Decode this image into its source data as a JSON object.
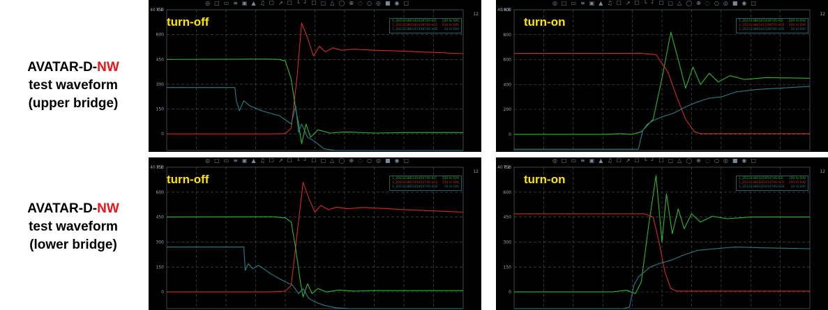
{
  "rows": [
    {
      "prefix": "AVATAR-D-",
      "highlight": "NW",
      "line2": "test waveform",
      "line3": "(upper bridge)"
    },
    {
      "prefix": "AVATAR-D-",
      "highlight": "NW",
      "line2": "test waveform",
      "line3": "(lower bridge)"
    }
  ],
  "colors": {
    "ice": "#d42a2a",
    "vce": "#2fb82f",
    "vge": "#2a7f86",
    "title": "#ffe600",
    "highlight": "#e8151b",
    "grid": "#4a5a5e"
  },
  "chart_data": [
    {
      "type": "line",
      "title": "turn-off",
      "corner_label": "40 ICE",
      "corner_right": "12",
      "y_ticks": [
        750,
        600,
        450,
        300,
        150,
        0
      ],
      "legend": [
        {
          "name": "1_2023138614132874S-ICE",
          "scale": "150 A/ DIV"
        },
        {
          "name": "1_2023138614132874S-VCE",
          "scale": "150 V/ DIV"
        },
        {
          "name": "1_2023138614132874S-VGE",
          "scale": "10 V/ DIV"
        }
      ],
      "x_range": [
        0,
        10
      ],
      "y_range": [
        -100,
        750
      ],
      "series": [
        {
          "color": "ice",
          "x": [
            0,
            3.5,
            4.0,
            4.2,
            4.4,
            4.55,
            4.75,
            4.95,
            5.15,
            5.35,
            5.6,
            5.9,
            6.3,
            7,
            8,
            10
          ],
          "y": [
            0,
            0,
            2,
            35,
            350,
            670,
            580,
            470,
            530,
            495,
            520,
            505,
            512,
            505,
            500,
            485
          ]
        },
        {
          "color": "vce",
          "x": [
            0,
            3.4,
            3.8,
            4.0,
            4.2,
            4.35,
            4.45,
            4.55,
            4.7,
            4.85,
            5.1,
            5.5,
            6,
            7,
            8,
            10
          ],
          "y": [
            450,
            452,
            450,
            440,
            330,
            150,
            60,
            -60,
            60,
            -20,
            25,
            5,
            12,
            5,
            8,
            8
          ]
        },
        {
          "color": "vge",
          "x": [
            0,
            2.3,
            2.35,
            2.45,
            2.6,
            2.8,
            3.2,
            3.8,
            4.2,
            4.35,
            4.45,
            4.55,
            4.75,
            4.95,
            5.3,
            5.7,
            6.2,
            10
          ],
          "y": [
            280,
            280,
            200,
            140,
            200,
            170,
            140,
            110,
            60,
            170,
            10,
            60,
            -20,
            -40,
            -90,
            -100,
            -100,
            -100
          ]
        }
      ]
    },
    {
      "type": "line",
      "title": "turn-on",
      "corner_label": "40 ICE",
      "corner_right": "12",
      "y_ticks": [
        1000,
        800,
        600,
        400,
        200,
        0
      ],
      "legend": [
        {
          "name": "1_20231386141328745-ICE",
          "scale": "200 A/ DIV"
        },
        {
          "name": "1_20231386141328745-VCE",
          "scale": "200 V/ DIV"
        },
        {
          "name": "1_20231386141328745-VGE",
          "scale": "10 V/ DIV"
        }
      ],
      "x_range": [
        0,
        10
      ],
      "y_range": [
        -130,
        1000
      ],
      "series": [
        {
          "color": "vce",
          "x": [
            0,
            3.0,
            3.6,
            4.0,
            4.3,
            4.7,
            5.0,
            5.3,
            5.55,
            5.8,
            6.05,
            6.3,
            6.6,
            6.9,
            7.3,
            7.8,
            8.5,
            10
          ],
          "y": [
            0,
            0,
            5,
            0,
            20,
            120,
            450,
            820,
            600,
            370,
            540,
            400,
            490,
            420,
            470,
            440,
            455,
            450
          ]
        },
        {
          "color": "ice",
          "x": [
            0,
            4.3,
            4.8,
            5.2,
            5.5,
            5.8,
            6.1,
            6.3,
            7,
            10
          ],
          "y": [
            650,
            650,
            640,
            500,
            300,
            120,
            20,
            5,
            5,
            5
          ]
        },
        {
          "color": "vge",
          "x": [
            0,
            3.8,
            4.2,
            4.35,
            4.5,
            4.7,
            5.0,
            5.4,
            5.8,
            6.2,
            6.6,
            7.0,
            7.5,
            8.2,
            9,
            10
          ],
          "y": [
            -120,
            -120,
            -120,
            30,
            80,
            110,
            140,
            170,
            220,
            260,
            290,
            300,
            340,
            360,
            370,
            385
          ]
        }
      ]
    },
    {
      "type": "line",
      "title": "turn-off",
      "corner_label": "40 ICE",
      "corner_right": "12",
      "y_ticks": [
        750,
        600,
        450,
        300,
        150,
        0
      ],
      "legend": [
        {
          "name": "1_2023138613545474S-ICE",
          "scale": "150 A/ DIV"
        },
        {
          "name": "1_2023138613545474S-VCE",
          "scale": "150 V/ DIV"
        },
        {
          "name": "1_2023138613545474S-VGE",
          "scale": "10 V/ DIV"
        }
      ],
      "x_range": [
        0,
        10
      ],
      "y_range": [
        -100,
        750
      ],
      "series": [
        {
          "color": "ice",
          "x": [
            0,
            3.5,
            4.0,
            4.2,
            4.4,
            4.6,
            4.8,
            5.0,
            5.2,
            5.45,
            5.75,
            6.1,
            6.6,
            7.3,
            8,
            10
          ],
          "y": [
            0,
            0,
            5,
            40,
            350,
            660,
            560,
            480,
            520,
            495,
            510,
            500,
            508,
            502,
            495,
            480
          ]
        },
        {
          "color": "vce",
          "x": [
            0,
            3.6,
            4.0,
            4.2,
            4.35,
            4.5,
            4.6,
            4.75,
            4.9,
            5.1,
            5.4,
            5.8,
            6.3,
            7,
            10
          ],
          "y": [
            450,
            452,
            445,
            420,
            260,
            70,
            -30,
            50,
            -10,
            20,
            0,
            12,
            5,
            8,
            8
          ]
        },
        {
          "color": "vge",
          "x": [
            0,
            2.6,
            2.65,
            2.75,
            2.9,
            3.1,
            3.5,
            3.9,
            4.25,
            4.45,
            4.6,
            4.8,
            5.0,
            5.3,
            5.7,
            6.2,
            6.8,
            10
          ],
          "y": [
            270,
            270,
            130,
            170,
            140,
            160,
            110,
            70,
            40,
            -10,
            20,
            -40,
            -60,
            -80,
            -95,
            -100,
            -100,
            -100
          ]
        }
      ]
    },
    {
      "type": "line",
      "title": "turn-on",
      "corner_label": "40 ICE",
      "corner_right": "12",
      "y_ticks": [
        750,
        600,
        450,
        300,
        150,
        0
      ],
      "legend": [
        {
          "name": "1_2023138613545474S-ICE",
          "scale": "150 A/ DIV"
        },
        {
          "name": "1_2023138613545474S-VCE",
          "scale": "150 V/ DIV"
        },
        {
          "name": "1_2023138613545474S-VGE",
          "scale": "10 V/ DIV"
        }
      ],
      "x_range": [
        0,
        10
      ],
      "y_range": [
        -100,
        750
      ],
      "series": [
        {
          "color": "vce",
          "x": [
            0,
            3.3,
            3.8,
            4.1,
            4.3,
            4.55,
            4.8,
            5.0,
            5.15,
            5.35,
            5.55,
            5.75,
            6.0,
            6.3,
            6.7,
            7.2,
            8,
            10
          ],
          "y": [
            0,
            0,
            10,
            -10,
            60,
            400,
            700,
            300,
            590,
            350,
            500,
            380,
            470,
            420,
            455,
            440,
            450,
            450
          ]
        },
        {
          "color": "ice",
          "x": [
            0,
            4.4,
            4.7,
            4.9,
            5.1,
            5.3,
            5.5,
            5.8,
            6.5,
            10
          ],
          "y": [
            470,
            470,
            450,
            300,
            120,
            20,
            5,
            5,
            5,
            5
          ]
        },
        {
          "color": "vge",
          "x": [
            0,
            3.7,
            3.9,
            4.05,
            4.2,
            4.4,
            4.6,
            4.9,
            5.3,
            5.7,
            6.2,
            6.8,
            7.5,
            8.5,
            10
          ],
          "y": [
            -100,
            -100,
            -90,
            40,
            90,
            120,
            150,
            170,
            190,
            220,
            250,
            260,
            270,
            265,
            260
          ]
        }
      ]
    }
  ]
}
